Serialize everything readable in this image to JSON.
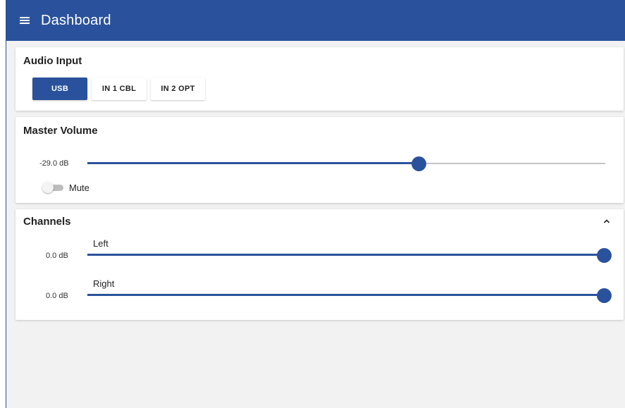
{
  "app": {
    "title": "Dashboard",
    "menu_icon": "hamburger-menu-icon",
    "accent_color": "#2a529c"
  },
  "audio_input": {
    "title": "Audio Input",
    "options": [
      {
        "label": "USB",
        "selected": true
      },
      {
        "label": "IN 1 CBL",
        "selected": false
      },
      {
        "label": "IN 2 OPT",
        "selected": false
      }
    ]
  },
  "master_volume": {
    "title": "Master Volume",
    "value_label": "-29.0 dB",
    "slider_fraction": 0.64,
    "mute_label": "Mute",
    "muted": false
  },
  "channels": {
    "title": "Channels",
    "collapse_icon": "chevron-up-icon",
    "items": [
      {
        "name": "Left",
        "value_label": "0.0 dB",
        "slider_fraction": 1.0
      },
      {
        "name": "Right",
        "value_label": "0.0 dB",
        "slider_fraction": 1.0
      }
    ]
  }
}
